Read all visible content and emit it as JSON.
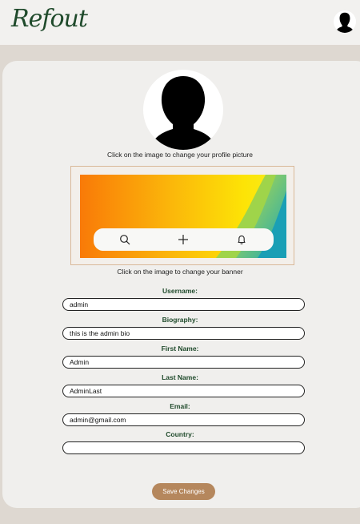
{
  "header": {
    "logo_text": "Refout",
    "avatar_icon": "user-silhouette-icon"
  },
  "profile": {
    "picture_icon": "user-silhouette-icon",
    "picture_caption": "Click on the image to change your profile picture",
    "banner_caption": "Click on the image to change your banner",
    "banner_icons": [
      "search-icon",
      "plus-icon",
      "bell-icon"
    ]
  },
  "form": {
    "username_label": "Username:",
    "username_value": "admin",
    "bio_label": "Biography:",
    "bio_value": "this is the admin bio",
    "first_name_label": "First Name:",
    "first_name_value": "Admin",
    "last_name_label": "Last Name:",
    "last_name_value": "AdminLast",
    "email_label": "Email:",
    "email_value": "admin@gmail.com",
    "country_label": "Country:",
    "country_value": ""
  },
  "actions": {
    "save_label": "Save Changes"
  },
  "colors": {
    "background": "#ded8d1",
    "card": "#f0efed",
    "logo": "#1f4a2b",
    "label": "#1f4a2b",
    "button": "#b5875d",
    "banner_frame": "#d9b899"
  }
}
